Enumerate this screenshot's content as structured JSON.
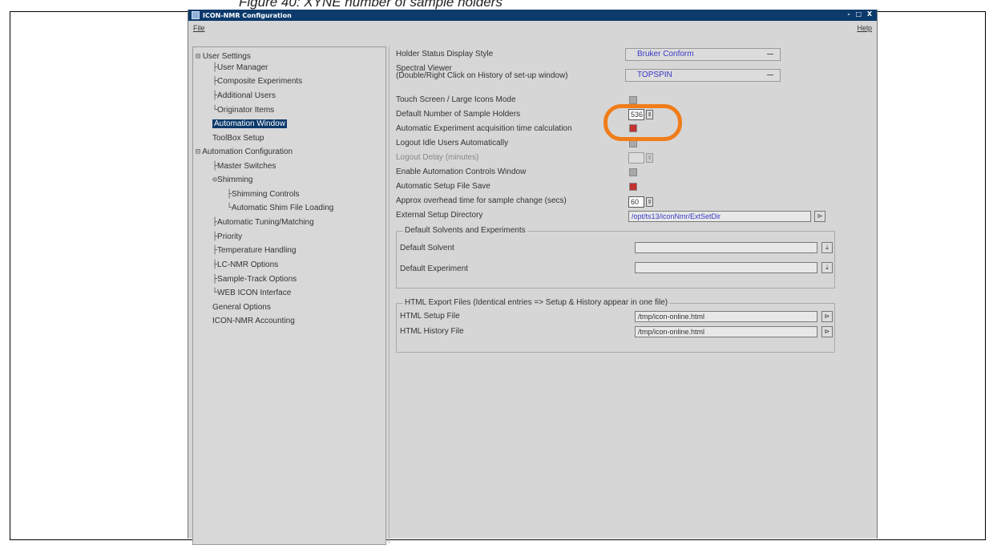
{
  "figure_caption": "Figure 40: XYNE number of sample holders",
  "window": {
    "title": "ICON-NMR Configuration",
    "controls": "- □ X"
  },
  "menubar": {
    "file": "File",
    "help": "Help"
  },
  "tree": {
    "user_settings": "User Settings",
    "user_manager": "User Manager",
    "composite_experiments": "Composite Experiments",
    "additional_users": "Additional Users",
    "originator_items": "Originator Items",
    "automation_window": "Automation Window",
    "toolbox_setup": "ToolBox Setup",
    "automation_configuration": "Automation Configuration",
    "master_switches": "Master Switches",
    "shimming": "Shimming",
    "shimming_controls": "Shimming Controls",
    "automatic_shim_file_loading": "Automatic Shim File Loading",
    "automatic_tuning_matching": "Automatic Tuning/Matching",
    "priority": "Priority",
    "temperature_handling": "Temperature Handling",
    "lc_nmr_options": "LC-NMR Options",
    "sample_track_options": "Sample-Track Options",
    "web_icon_interface": "WEB ICON Interface",
    "general_options": "General Options",
    "icon_nmr_accounting": "ICON-NMR Accounting"
  },
  "settings": {
    "holder_status_label": "Holder Status Display Style",
    "holder_status_value": "Bruker Conform",
    "spectral_viewer_label_1": "Spectral Viewer",
    "spectral_viewer_label_2": "(Double/Right Click on History of set-up window)",
    "spectral_viewer_value": "TOPSPIN",
    "touch_screen_label": "Touch Screen / Large Icons Mode",
    "default_holders_label": "Default Number of Sample Holders",
    "default_holders_value": "536",
    "auto_exp_time_label": "Automatic Experiment acquisition time calculation",
    "logout_idle_label": "Logout Idle Users Automatically",
    "logout_delay_label": "Logout Delay (minutes)",
    "enable_controls_label": "Enable Automation Controls Window",
    "auto_setup_save_label": "Automatic Setup File Save",
    "overhead_time_label": "Approx overhead time for sample change (secs)",
    "overhead_time_value": "60",
    "external_setup_label": "External Setup Directory",
    "external_setup_value": "/opt/ts13/iconNmr/ExtSetDir"
  },
  "defaults_group": {
    "title": "Default Solvents and Experiments",
    "solvent_label": "Default Solvent",
    "experiment_label": "Default Experiment"
  },
  "html_group": {
    "title": "HTML Export Files (Identical entries => Setup & History appear in one file)",
    "setup_label": "HTML Setup File",
    "setup_value": "/tmp/icon-online.html",
    "history_label": "HTML History File",
    "history_value": "/tmp/icon-online.html"
  },
  "colors": {
    "highlight": "#f07d1a",
    "titlebar": "#0b3a6b",
    "checked": "#c43030"
  }
}
